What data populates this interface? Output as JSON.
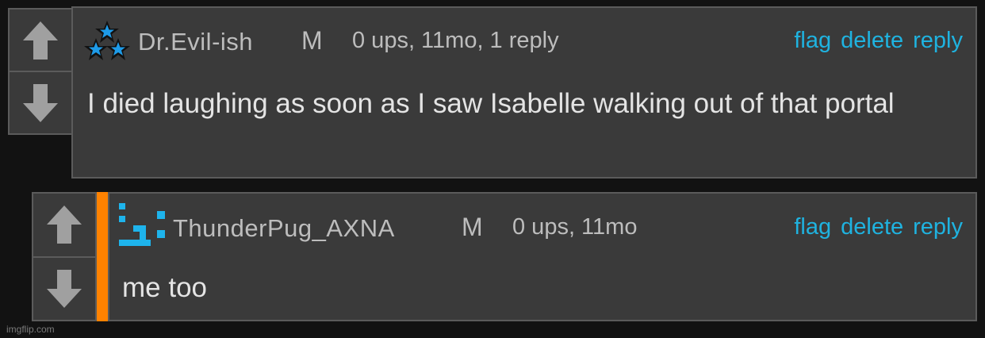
{
  "comments": [
    {
      "username": "Dr.Evil-ish",
      "badge": "M",
      "meta": "0 ups, 11mo, 1 reply",
      "actions": {
        "flag": "flag",
        "delete": "delete",
        "reply": "reply"
      },
      "body": "I died laughing as soon as I saw Isabelle walking out of that portal",
      "avatar_icon": "three-stars-icon"
    },
    {
      "username": "ThunderPug_AXNA",
      "badge": "M",
      "meta": "0 ups, 11mo",
      "actions": {
        "flag": "flag",
        "delete": "delete",
        "reply": "reply"
      },
      "body": "me too",
      "avatar_icon": "pixel-avatar-icon"
    }
  ],
  "watermark": "imgflip.com",
  "colors": {
    "background": "#121212",
    "panel": "#3a3a3a",
    "border": "#5b5b5b",
    "action_link": "#1fb3e0",
    "thread_bar": "#ff8200",
    "arrow": "#a0a0a0",
    "star_blue": "#1e9be8"
  }
}
